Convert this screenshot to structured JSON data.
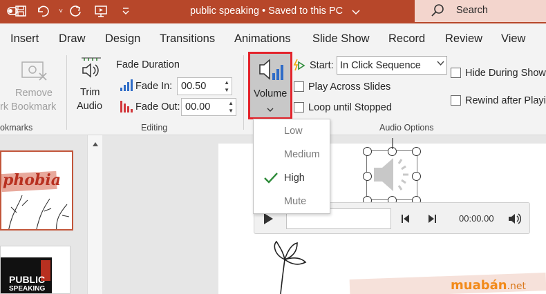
{
  "titlebar": {
    "doc_title": "public speaking • Saved to this PC",
    "search_label": "Search"
  },
  "tabs": [
    "Insert",
    "Draw",
    "Design",
    "Transitions",
    "Animations",
    "Slide Show",
    "Record",
    "Review",
    "View"
  ],
  "ribbon": {
    "bookmarks": {
      "remove_label_1": "Remove",
      "remove_label_2": "Bookmark",
      "left_label": "rk",
      "group": "okmarks"
    },
    "editing": {
      "trim_1": "Trim",
      "trim_2": "Audio",
      "fade_duration": "Fade Duration",
      "fade_in_label": "Fade In:",
      "fade_in_value": "00.50",
      "fade_out_label": "Fade Out:",
      "fade_out_value": "00.00",
      "group": "Editing"
    },
    "volume": {
      "label": "Volume"
    },
    "audio_options": {
      "start_label": "Start:",
      "start_value": "In Click Sequence",
      "play_across": "Play Across Slides",
      "loop": "Loop until Stopped",
      "hide_during": "Hide During Show",
      "rewind": "Rewind after Playi",
      "group": "Audio Options"
    }
  },
  "volume_menu": {
    "items": [
      "Low",
      "Medium",
      "High",
      "Mute"
    ],
    "selected": "High"
  },
  "thumbnails": {
    "slide1_text": "phobia",
    "slide2_line1": "PUBLIC",
    "slide2_line2": "SPEAKING"
  },
  "player": {
    "time": "00:00.00"
  },
  "watermark": {
    "brand": "muabán",
    "tld": ".net"
  },
  "colors": {
    "accent": "#b7472a",
    "highlight": "#e3232b",
    "check": "#2e8b3a"
  }
}
